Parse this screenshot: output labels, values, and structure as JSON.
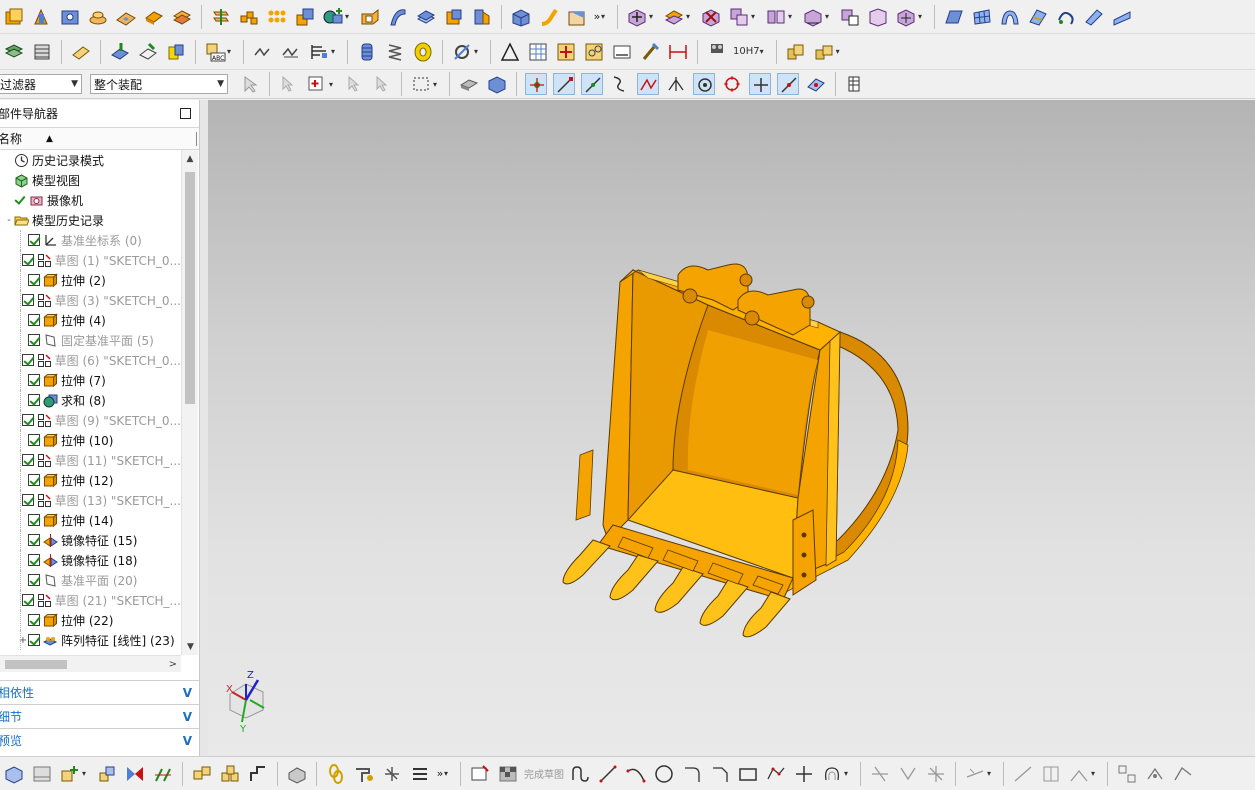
{
  "selection_bar": {
    "filter_value": "过滤器",
    "scope_value": "整个装配",
    "tolerance_label": "10H7"
  },
  "navigator": {
    "title": "部件导航器",
    "column_name": "名称",
    "nodes": [
      {
        "label": "历史记录模式",
        "icon": "clock-icon",
        "level": 0,
        "dim": false
      },
      {
        "label": "模型视图",
        "icon": "model-views-icon",
        "level": 0,
        "dim": false
      },
      {
        "label": "摄像机",
        "icon": "camera-icon",
        "level": 0,
        "dim": false
      },
      {
        "label": "模型历史记录",
        "icon": "folder-open-icon",
        "level": 0,
        "dim": false
      },
      {
        "label": "基准坐标系 (0)",
        "icon": "datum-csys-icon",
        "level": 1,
        "dim": true
      },
      {
        "label": "草图 (1) \"SKETCH_0...",
        "icon": "sketch-icon",
        "level": 1,
        "dim": true
      },
      {
        "label": "拉伸 (2)",
        "icon": "extrude-icon",
        "level": 1,
        "dim": false
      },
      {
        "label": "草图 (3) \"SKETCH_0...",
        "icon": "sketch-icon",
        "level": 1,
        "dim": true
      },
      {
        "label": "拉伸 (4)",
        "icon": "extrude-icon",
        "level": 1,
        "dim": false
      },
      {
        "label": "固定基准平面 (5)",
        "icon": "datum-plane-icon",
        "level": 1,
        "dim": true
      },
      {
        "label": "草图 (6) \"SKETCH_0...",
        "icon": "sketch-icon",
        "level": 1,
        "dim": true
      },
      {
        "label": "拉伸 (7)",
        "icon": "extrude-icon",
        "level": 1,
        "dim": false
      },
      {
        "label": "求和 (8)",
        "icon": "unite-icon",
        "level": 1,
        "dim": false
      },
      {
        "label": "草图 (9) \"SKETCH_0...",
        "icon": "sketch-icon",
        "level": 1,
        "dim": true
      },
      {
        "label": "拉伸 (10)",
        "icon": "extrude-icon",
        "level": 1,
        "dim": false
      },
      {
        "label": "草图 (11) \"SKETCH_...",
        "icon": "sketch-icon",
        "level": 1,
        "dim": true
      },
      {
        "label": "拉伸 (12)",
        "icon": "extrude-icon",
        "level": 1,
        "dim": false
      },
      {
        "label": "草图 (13) \"SKETCH_...",
        "icon": "sketch-icon",
        "level": 1,
        "dim": true
      },
      {
        "label": "拉伸 (14)",
        "icon": "extrude-icon",
        "level": 1,
        "dim": false
      },
      {
        "label": "镜像特征 (15)",
        "icon": "mirror-feature-icon",
        "level": 1,
        "dim": false
      },
      {
        "label": "镜像特征 (18)",
        "icon": "mirror-feature-icon",
        "level": 1,
        "dim": false
      },
      {
        "label": "基准平面 (20)",
        "icon": "datum-plane-icon",
        "level": 1,
        "dim": true
      },
      {
        "label": "草图 (21) \"SKETCH_...",
        "icon": "sketch-icon",
        "level": 1,
        "dim": true
      },
      {
        "label": "拉伸 (22)",
        "icon": "extrude-icon",
        "level": 1,
        "dim": false
      },
      {
        "label": "阵列特征 [线性] (23)",
        "icon": "pattern-feature-icon",
        "level": 1,
        "dim": false
      }
    ]
  },
  "panels": {
    "dependencies": "相依性",
    "details": "细节",
    "preview": "预览"
  },
  "sketch_bar": {
    "finish_sketch": "完成草图"
  },
  "triad": {
    "x": "X",
    "y": "Y",
    "z": "Z"
  },
  "colors": {
    "bucket_light": "#ffc21a",
    "bucket_mid": "#f5a300",
    "bucket_dark": "#d98a00",
    "accent_blue": "#1a6fc2"
  }
}
